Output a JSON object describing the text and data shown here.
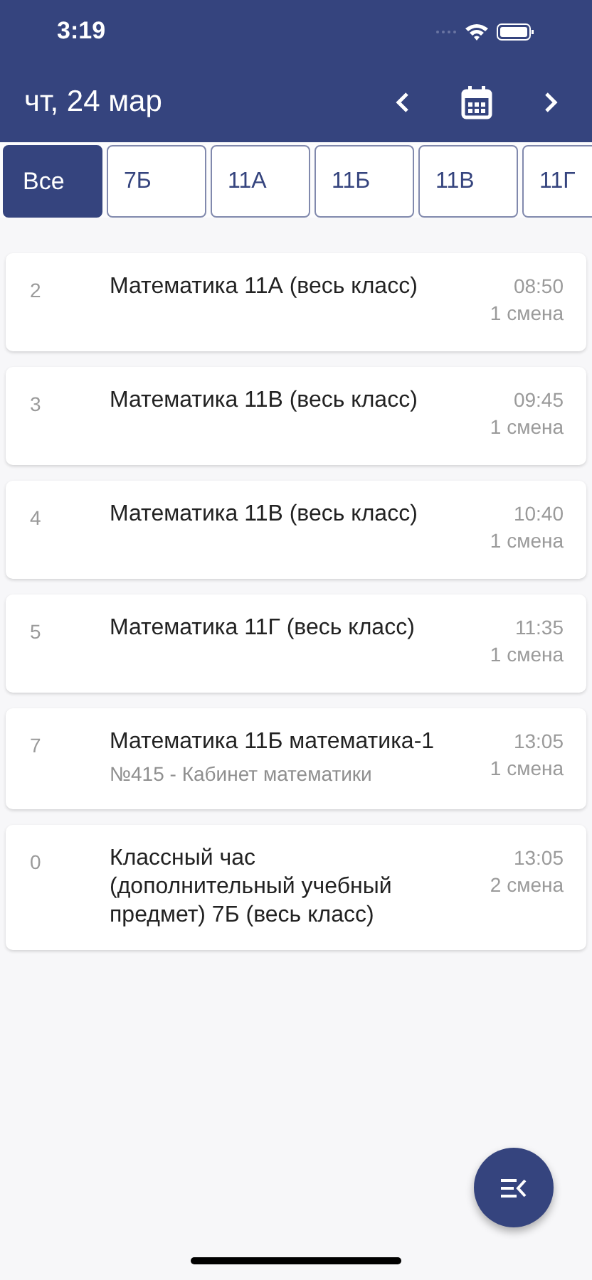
{
  "status_bar": {
    "time": "3:19"
  },
  "header": {
    "date": "чт, 24 мар"
  },
  "tabs": [
    {
      "label": "Все",
      "selected": true
    },
    {
      "label": "7Б",
      "selected": false
    },
    {
      "label": "11А",
      "selected": false
    },
    {
      "label": "11Б",
      "selected": false
    },
    {
      "label": "11В",
      "selected": false
    },
    {
      "label": "11Г",
      "selected": false
    }
  ],
  "lessons": [
    {
      "number": "2",
      "title": "Математика 11А (весь класс)",
      "time": "08:50",
      "shift": "1 смена"
    },
    {
      "number": "3",
      "title": "Математика 11В (весь класс)",
      "time": "09:45",
      "shift": "1 смена"
    },
    {
      "number": "4",
      "title": "Математика 11В (весь класс)",
      "time": "10:40",
      "shift": "1 смена"
    },
    {
      "number": "5",
      "title": "Математика 11Г (весь класс)",
      "time": "11:35",
      "shift": "1 смена"
    },
    {
      "number": "7",
      "title": "Математика 11Б математика-1",
      "room": "№415 - Кабинет математики",
      "time": "13:05",
      "shift": "1 смена"
    },
    {
      "number": "0",
      "title": "Классный час (дополнительный учебный предмет) 7Б (весь класс)",
      "time": "13:05",
      "shift": "2 смена"
    }
  ]
}
